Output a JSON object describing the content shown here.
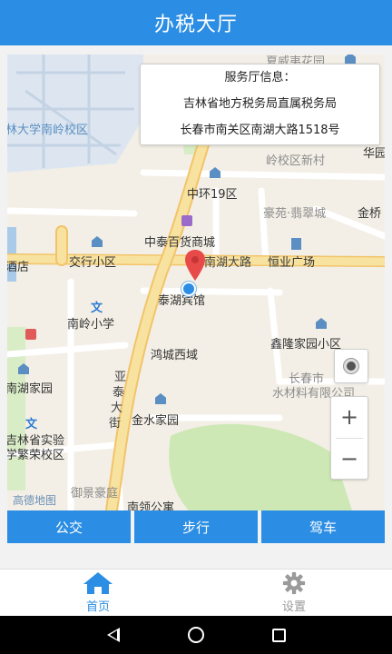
{
  "header": {
    "title": "办税大厅"
  },
  "map": {
    "labels": {
      "xiawei": "夏威夷花园",
      "jida": "林大学南岭校区",
      "huayuan": "华园",
      "lingxiao": "岭校区新村",
      "zhonghuan": "中环19区",
      "haoyuan": "豪苑·翡翠城",
      "jinqiao": "金桥",
      "zhongtai": "中泰百货商城",
      "jiudian": "酒店",
      "jiaoxing": "交行小区",
      "nanhu_road": "南湖大路",
      "hengye": "恒业广场",
      "taihu": "泰湖宾馆",
      "nanling": "南岭小学",
      "hongcheng": "鸿城西域",
      "xinlong": "鑫隆家园小区",
      "nanhujiayuan": "南湖家园",
      "changchun_a": "长春市",
      "changchun_b": "水材料有限公司",
      "jinshui": "金水家园",
      "yatai_a": "亚",
      "yatai_b": "泰",
      "yatai_c": "大",
      "yatai_d": "街",
      "jilin_a": "吉林省实验",
      "jilin_b": "学繁荣校区",
      "yujing": "御景豪庭",
      "nanjing": "南领公寓",
      "logo": "高德地图"
    }
  },
  "info_box": {
    "heading": "服务厅信息：",
    "name": "吉林省地方税务局直属税务局",
    "address": "长春市南关区南湖大路1518号"
  },
  "zoom": {
    "in": "+",
    "out": "−"
  },
  "route_buttons": [
    {
      "label": "公交"
    },
    {
      "label": "步行"
    },
    {
      "label": "驾车"
    }
  ],
  "tabs": [
    {
      "label": "首页",
      "icon": "home-icon",
      "active": true
    },
    {
      "label": "设置",
      "icon": "gear-icon",
      "active": false
    }
  ],
  "colors": {
    "primary": "#2b8de3",
    "road": "#f6d98a",
    "green": "#cde8b5",
    "water": "#a9cbe8"
  }
}
